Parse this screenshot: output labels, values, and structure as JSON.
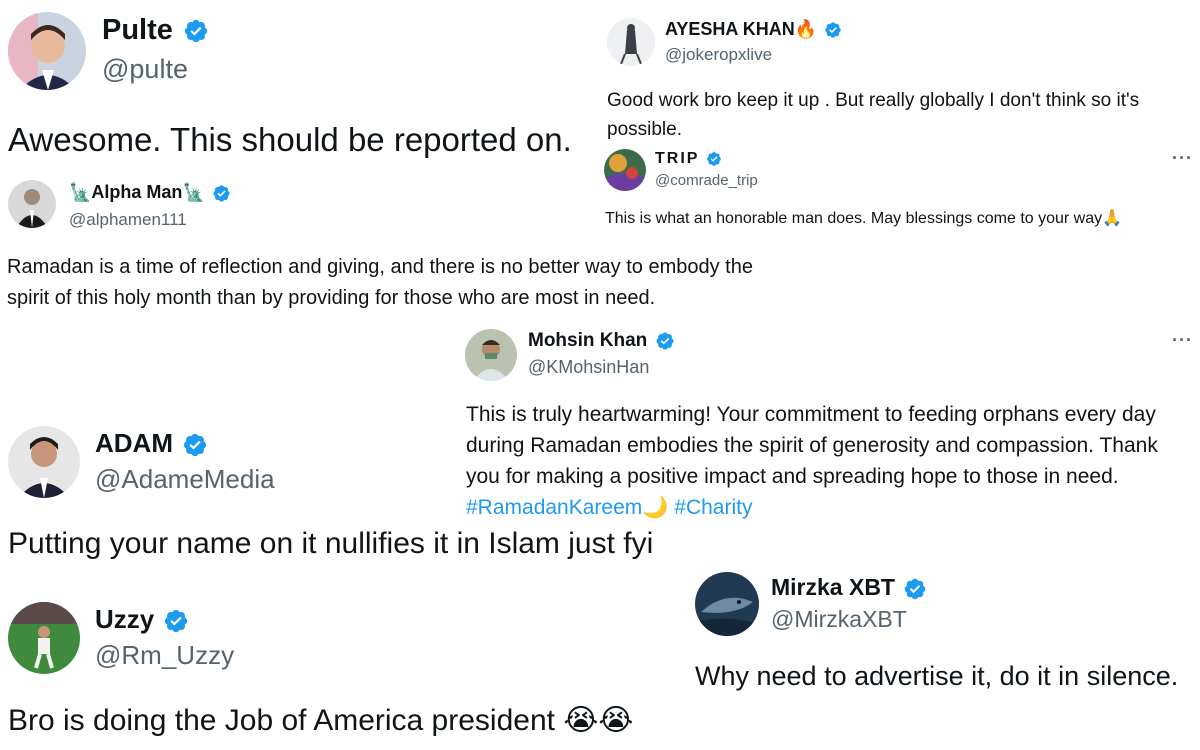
{
  "colors": {
    "verified": "#1d9bf0",
    "text": "#0f1419",
    "muted": "#536471",
    "link": "#1d9bf0"
  },
  "icons": {
    "verified": "verified-badge-icon",
    "more": "more-options-icon"
  },
  "tweets": {
    "pulte": {
      "name": "Pulte",
      "handle": "@pulte",
      "text": "Awesome. This should be reported on."
    },
    "ayesha": {
      "name": "AYESHA KHAN",
      "emoji": "🔥",
      "handle": "@jokeropxlive",
      "text": "Good work bro keep it up  . But really globally I don't think so it's possible."
    },
    "trip": {
      "name": "TRIP",
      "handle": "@comrade_trip",
      "more": "···",
      "text": "This is what an honorable man does. May blessings come to your way",
      "emoji": "🙏"
    },
    "alpha": {
      "emoji": "🗽",
      "name": "Alpha Man",
      "handle": "@alphamen111",
      "text": "Ramadan is a time of reflection and giving, and there is no better way to embody the spirit of this holy month than by providing for those who are most in need."
    },
    "mohsin": {
      "name": "Mohsin Khan",
      "handle": "@KMohsinHan",
      "more": "···",
      "text": "This is truly heartwarming! Your commitment to feeding orphans every day during Ramadan embodies the spirit of generosity and compassion. Thank you for making a positive impact and spreading hope to those in need.",
      "hashtag1": "#RamadanKareem",
      "moon": "🌙",
      "hashtag2": "#Charity"
    },
    "adam": {
      "name": "ADAM",
      "handle": "@AdameMedia",
      "text": "Putting your name on it nullifies it in Islam just fyi"
    },
    "mirzka": {
      "name": "Mirzka XBT",
      "handle": "@MirzkaXBT",
      "text": "Why need to advertise it, do it in silence."
    },
    "uzzy": {
      "name": "Uzzy",
      "handle": "@Rm_Uzzy",
      "text": "Bro is doing the Job of America president",
      "emoji": "😭😭"
    }
  }
}
